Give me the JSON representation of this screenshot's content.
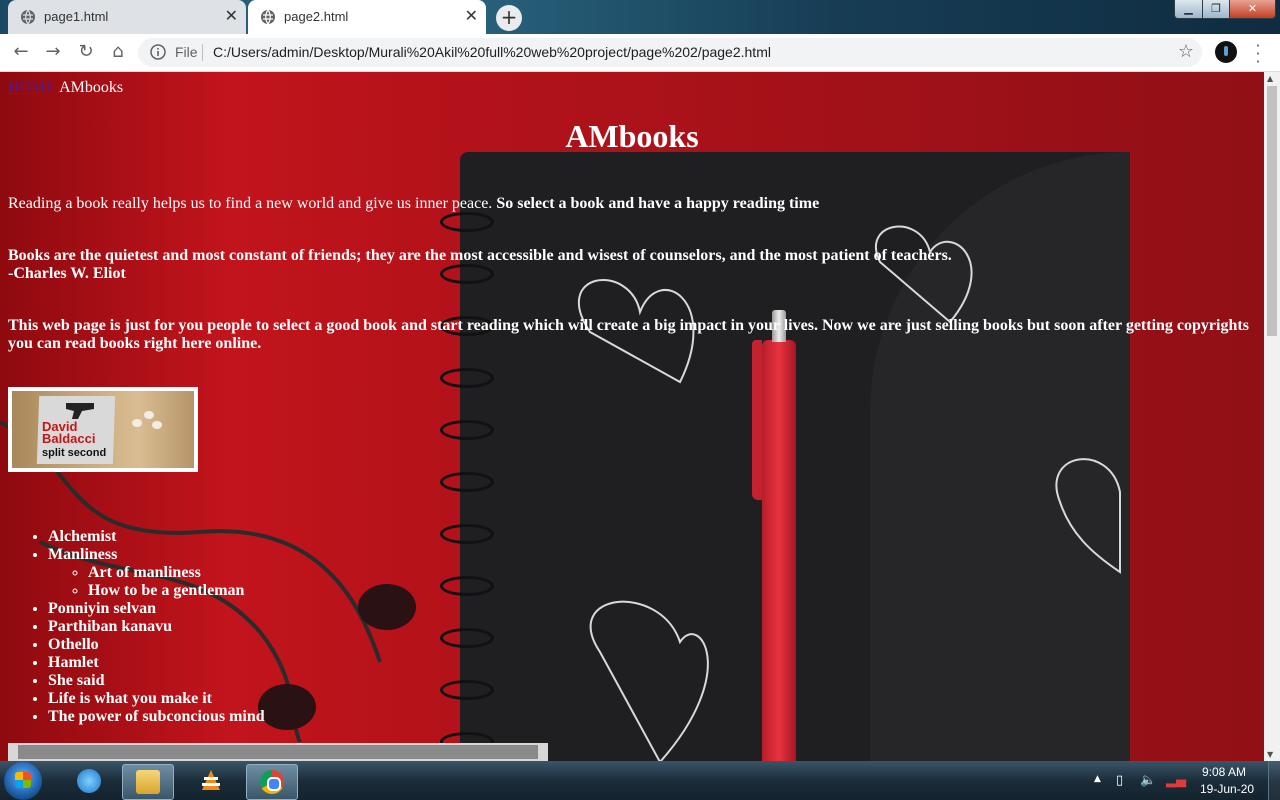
{
  "browser": {
    "tabs": [
      {
        "title": "page1.html",
        "active": false
      },
      {
        "title": "page2.html",
        "active": true
      }
    ],
    "new_tab_icon": "plus-icon",
    "address": {
      "scheme_label": "File",
      "url": "C:/Users/admin/Desktop/Murali%20Akil%20full%20web%20project/page%202/page2.html"
    }
  },
  "page": {
    "nav": {
      "home_link": "HOME",
      "brand": "AMbooks"
    },
    "heading": "AMbooks",
    "intro_plain": "Reading a book really helps us to find a new world and give us inner peace.",
    "intro_bold": " So select a book and have a happy reading time",
    "quote": "Books are the quietest and most constant of friends; they are the most accessible and wisest of counselors, and the most patient of teachers.",
    "quote_author": "-Charles W. Eliot",
    "description": "This web page is just for you people to select a good book and start reading which will create a big impact in your lives. Now we are just selling books but soon after getting copyrights you can read books right here online.",
    "book_image": {
      "author": "David Baldacci",
      "author_line1": "David",
      "author_line2": "Baldacci",
      "title": "split second"
    },
    "books": {
      "alchemist": "Alchemist",
      "manliness": "Manliness",
      "manliness_sub": [
        "Art of manliness",
        "How to be a gentleman"
      ],
      "rest": [
        "Ponniyin selvan",
        "Parthiban kanavu",
        "Othello",
        "Hamlet",
        "She said",
        "Life is what you make it",
        "The power of subconcious mind"
      ]
    }
  },
  "taskbar": {
    "apps": [
      "internet-explorer",
      "file-explorer",
      "vlc",
      "chrome"
    ],
    "clock_time": "9:08 AM",
    "clock_date": "19-Jun-20"
  },
  "colors": {
    "page_background": "#b5121a",
    "visited_link": "#551a8b",
    "text": "#ffffff"
  }
}
